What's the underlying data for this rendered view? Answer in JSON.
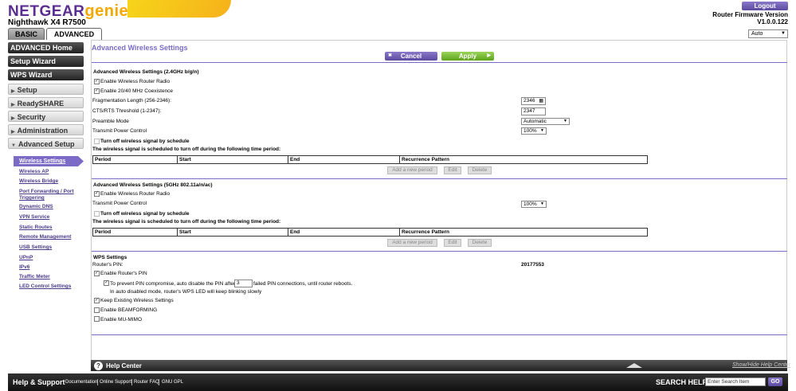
{
  "header": {
    "brand": "NETGEAR",
    "brand_suffix": "genie",
    "model": "Nighthawk X4 R7500",
    "logout": "Logout",
    "fw_label": "Router Firmware Version",
    "fw_version": "V1.0.0.122",
    "language": "Auto"
  },
  "tabs": {
    "basic": "BASIC",
    "advanced": "ADVANCED"
  },
  "sidebar": {
    "buttons": [
      "ADVANCED Home",
      "Setup Wizard",
      "WPS Wizard"
    ],
    "categories": [
      "Setup",
      "ReadySHARE",
      "Security",
      "Administration",
      "Advanced Setup"
    ],
    "active_sub": "Wireless Settings",
    "subs": [
      "Wireless AP",
      "Wireless Bridge",
      "Port Forwarding / Port Triggering",
      "Dynamic DNS",
      "VPN Service",
      "Static Routes",
      "Remote Management",
      "USB Settings",
      "UPnP",
      "IPv6",
      "Traffic Meter",
      "LED Control Settings"
    ]
  },
  "main": {
    "title": "Advanced Wireless Settings",
    "cancel": "Cancel",
    "apply": "Apply",
    "s24": {
      "heading": "Advanced Wireless Settings (2.4GHz b/g/n)",
      "enable_radio": "Enable Wireless Router Radio",
      "coexist": "Enable 20/40 MHz Coexistence",
      "frag_label": "Fragmentation Length (256-2346):",
      "frag_value": "2346",
      "cts_label": "CTS/RTS Threshold (1-2347):",
      "cts_value": "2347",
      "preamble_label": "Preamble Mode",
      "preamble_value": "Automatic",
      "tx_label": "Transmit Power Control",
      "tx_value": "100%",
      "schedule": "Turn off wireless signal by schedule",
      "schedule_note": "The wireless signal is scheduled to turn off during the following time period:"
    },
    "s5": {
      "heading": "Advanced Wireless Settings (5GHz 802.11a/n/ac)",
      "enable_radio": "Enable Wireless Router Radio",
      "tx_label": "Transmit Power Control",
      "tx_value": "100%",
      "schedule": "Turn off wireless signal by schedule",
      "schedule_note": "The wireless signal is scheduled to turn off during the following time period:"
    },
    "table_headers": [
      "Period",
      "Start",
      "End",
      "Recurrence Pattern"
    ],
    "add_period": "Add a new period",
    "edit": "Edit",
    "delete": "Delete",
    "wps": {
      "heading": "WPS Settings",
      "pin_label": "Router's PIN:",
      "pin_value": "20177553",
      "enable_pin": "Enable Router's PIN",
      "prevent_pre": "To prevent PIN compromise, auto disable the PIN after",
      "prevent_value": "3",
      "prevent_post": "failed PIN connections, until router reboots.",
      "auto_note": "In auto disabled mode, router's WPS LED will keep blinking slowly",
      "keep": "Keep Existing Wireless Settings",
      "beam": "Enable BEAMFORMING",
      "mumimo": "Enable MU-MIMO"
    }
  },
  "help": {
    "title": "Help Center",
    "toggle": "Show/Hide Help Center"
  },
  "footer": {
    "title": "Help & Support",
    "links": [
      "Documentation",
      "Online Support",
      "Router FAQ",
      "GNU GPL"
    ],
    "search_label": "SEARCH HELP",
    "search_placeholder": "Enter Search Item",
    "go": "GO"
  }
}
